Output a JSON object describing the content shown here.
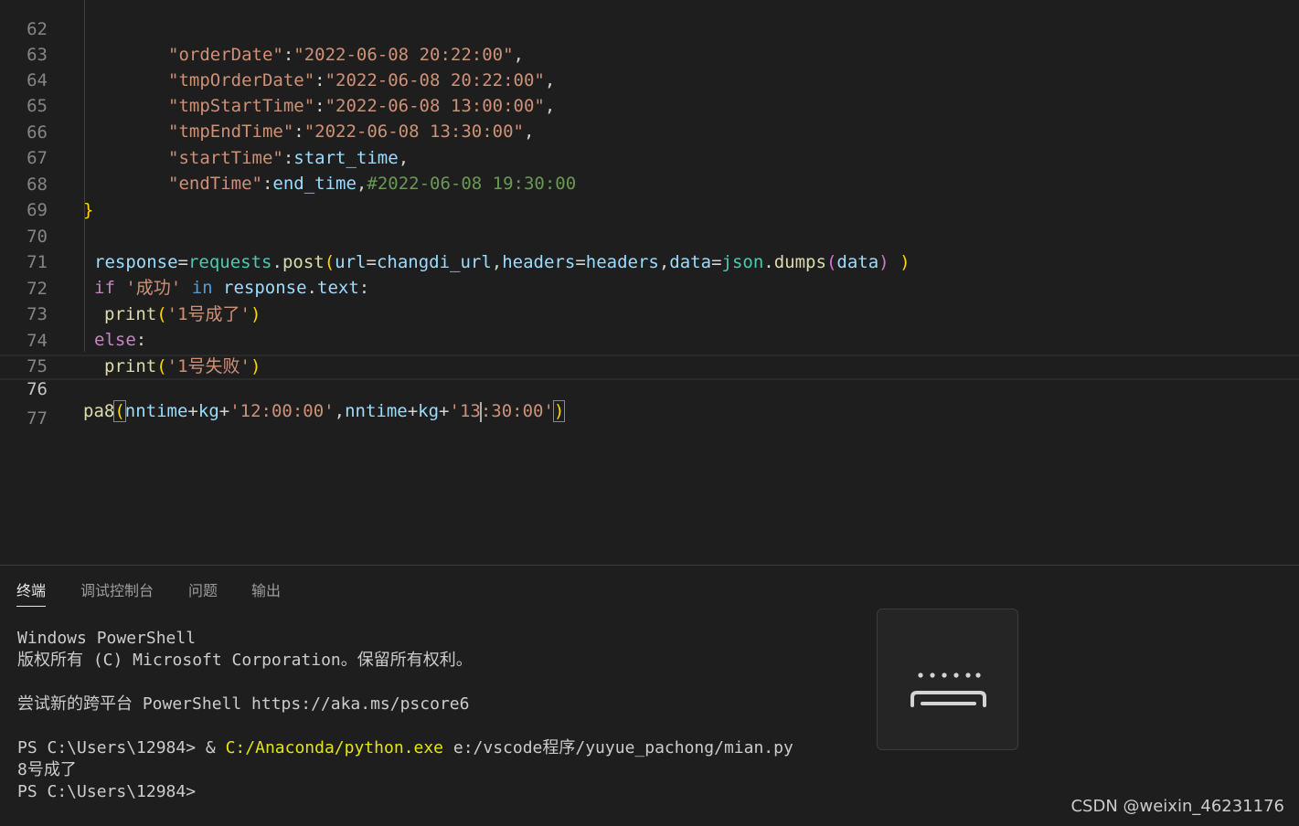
{
  "editor": {
    "line_numbers": [
      "62",
      "63",
      "64",
      "65",
      "66",
      "67",
      "68",
      "69",
      "70",
      "71",
      "72",
      "73",
      "74",
      "75",
      "76",
      "77"
    ],
    "active_line": "76",
    "lines": {
      "l62": {
        "key": "\"orderDate\"",
        "val": "\"2022-06-08 20:22:00\""
      },
      "l63": {
        "key": "\"tmpOrderDate\"",
        "val": "\"2022-06-08 20:22:00\""
      },
      "l64": {
        "key": "\"tmpStartTime\"",
        "val": "\"2022-06-08 13:00:00\""
      },
      "l65": {
        "key": "\"tmpEndTime\"",
        "val": "\"2022-06-08 13:30:00\""
      },
      "l66": {
        "key": "\"startTime\"",
        "val": "start_time"
      },
      "l67": {
        "key": "\"endTime\"",
        "val": "end_time",
        "comment": "#2022-06-08 19:30:00"
      },
      "l68": {
        "brace": "}"
      },
      "l70": {
        "var": "response",
        "mod": "requests",
        "fn": "post",
        "arg1": "url",
        "arg1v": "changdi_url",
        "arg2": "headers",
        "arg2v": "headers",
        "arg3": "data",
        "mod2": "json",
        "fn2": "dumps",
        "arg3v": "data"
      },
      "l71": {
        "kw": "if",
        "str": "'成功'",
        "kw2": "in",
        "var": "response",
        "attr": "text"
      },
      "l72": {
        "fn": "print",
        "str": "'1号成了'"
      },
      "l73": {
        "kw": "else"
      },
      "l74": {
        "fn": "print",
        "str": "'1号失败'"
      },
      "l76": {
        "fn": "pa8",
        "v1": "nntime",
        "v2": "kg",
        "s1": "'12:00:00'",
        "v3": "nntime",
        "v4": "kg",
        "s2a": "'13",
        "s2b": ":30:00'"
      }
    }
  },
  "panel": {
    "tabs": [
      "终端",
      "调试控制台",
      "问题",
      "输出"
    ],
    "active_tab": "终端",
    "terminal": {
      "line1": "Windows PowerShell",
      "line2": "版权所有 (C) Microsoft Corporation。保留所有权利。",
      "line3": "尝试新的跨平台 PowerShell https://aka.ms/pscore6",
      "prompt": "PS C:\\Users\\12984>",
      "amp": " & ",
      "exe": "C:/Anaconda/python.exe",
      "script": " e:/vscode程序/yuyue_pachong/mian.py",
      "output": "8号成了",
      "prompt2": "PS C:\\Users\\12984>"
    }
  },
  "floating_button": {
    "icon": "keyboard-icon"
  },
  "watermark": "CSDN @weixin_46231176"
}
